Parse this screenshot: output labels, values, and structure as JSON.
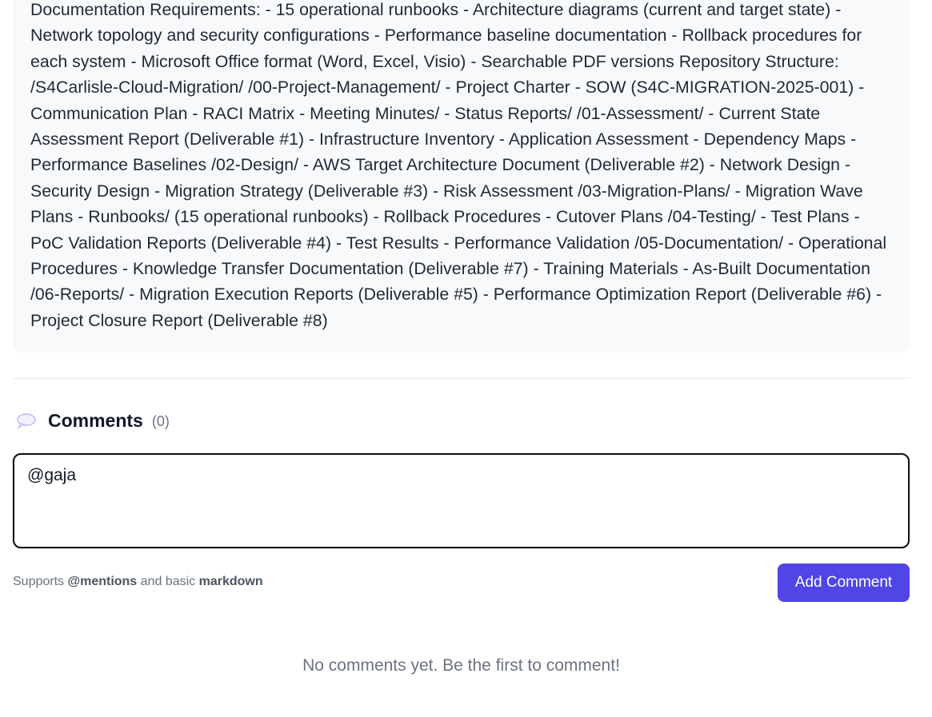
{
  "description": {
    "text": "Documentation Requirements: - 15 operational runbooks - Architecture diagrams (current and target state) - Network topology and security configurations - Performance baseline documentation - Rollback procedures for each system - Microsoft Office format (Word, Excel, Visio) - Searchable PDF versions Repository Structure: /S4Carlisle-Cloud-Migration/ /00-Project-Management/ - Project Charter - SOW (S4C-MIGRATION-2025-001) - Communication Plan - RACI Matrix - Meeting Minutes/ - Status Reports/ /01-Assessment/ - Current State Assessment Report (Deliverable #1) - Infrastructure Inventory - Application Assessment - Dependency Maps - Performance Baselines /02-Design/ - AWS Target Architecture Document (Deliverable #2) - Network Design - Security Design - Migration Strategy (Deliverable #3) - Risk Assessment /03-Migration-Plans/ - Migration Wave Plans - Runbooks/ (15 operational runbooks) - Rollback Procedures - Cutover Plans /04-Testing/ - Test Plans - PoC Validation Reports (Deliverable #4) - Test Results - Performance Validation /05-Documentation/ - Operational Procedures - Knowledge Transfer Documentation (Deliverable #7) - Training Materials - As-Built Documentation /06-Reports/ - Migration Execution Reports (Deliverable #5) - Performance Optimization Report (Deliverable #6) - Project Closure Report (Deliverable #8)"
  },
  "comments": {
    "icon": "speech-bubble-icon",
    "title": "Comments",
    "count": "(0)",
    "input_value": "@gaja",
    "hint_prefix": "Supports ",
    "hint_mentions": "@mentions",
    "hint_middle": " and basic ",
    "hint_markdown": "markdown",
    "add_button_label": "Add Comment",
    "empty_message": "No comments yet. Be the first to comment!"
  },
  "colors": {
    "accent": "#4f46e5",
    "card_bg": "#f8f9fb",
    "muted_text": "#6b7280"
  }
}
